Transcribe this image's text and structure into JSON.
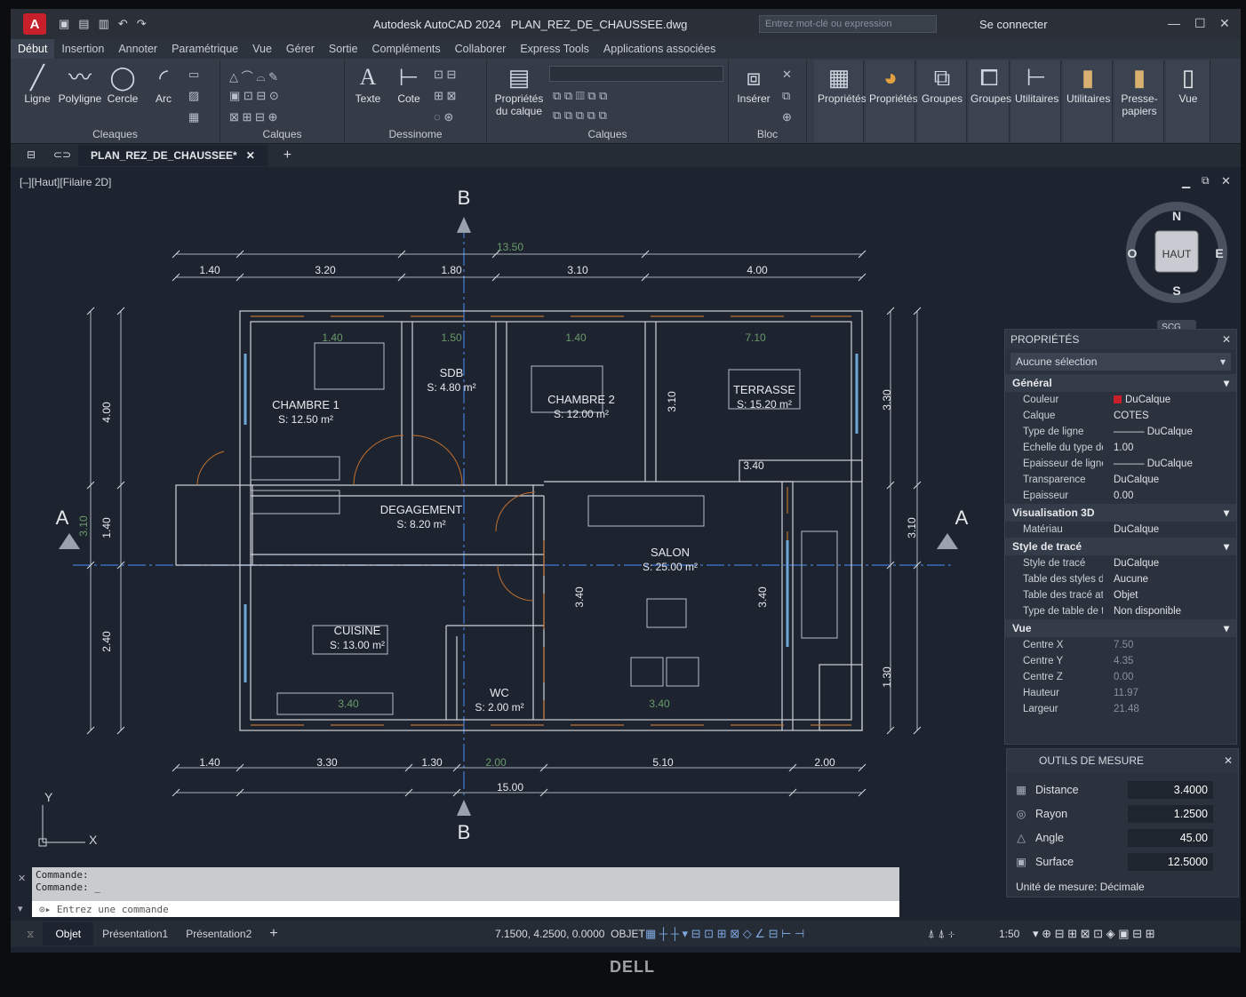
{
  "window": {
    "app_icon": "A",
    "title": "Autodesk AutoCAD 2024",
    "filename": "PLAN_REZ_DE_CHAUSSEE.dwg",
    "search_placeholder": "Entrez mot-clé ou expression",
    "signin": "Se connecter"
  },
  "ribbon_tabs": [
    "Début",
    "Insertion",
    "Annoter",
    "Paramétrique",
    "Vue",
    "Gérer",
    "Sortie",
    "Compléments",
    "Collaborer",
    "Express Tools",
    "Applications associées"
  ],
  "ribbon": {
    "tools": {
      "ligne": "Ligne",
      "polyligne": "Polyligne",
      "cercle": "Cercle",
      "arc": "Arc",
      "texte": "Texte",
      "cote": "Cote",
      "proprietes_calque": "Propriétés du calque",
      "inserer": "Insérer",
      "proprietes": "Propriétés",
      "proprietes2": "Propriétés",
      "groupes": "Groupes",
      "groupes2": "Groupes",
      "utilitaires": "Utilitaires",
      "utilitaires2": "Utilitaires",
      "presse_papiers": "Presse-papiers",
      "vue": "Vue"
    },
    "panels": {
      "dessiner": "Cleaques",
      "modifier": "Calques",
      "annotation": "Dessinome",
      "calques": "Calques",
      "bloc": "Bloc"
    }
  },
  "doc_tab": "PLAN_REZ_DE_CHAUSSEE*",
  "viewport_label": "[–][Haut][Filaire 2D]",
  "viewcube": {
    "top": "HAUT",
    "n": "N",
    "s": "S",
    "e": "E",
    "w": "O",
    "wcs": "SCG"
  },
  "plan": {
    "rooms": [
      {
        "name": "CHAMBRE 1",
        "area": "S: 12.50 m²"
      },
      {
        "name": "SDB",
        "area": "S: 4.80 m²"
      },
      {
        "name": "CHAMBRE 2",
        "area": "S: 12.00 m²"
      },
      {
        "name": "TERRASSE",
        "area": "S: 15.20 m²"
      },
      {
        "name": "DEGAGEMENT",
        "area": "S: 8.20 m²"
      },
      {
        "name": "SALON",
        "area": "S: 25.00 m²"
      },
      {
        "name": "CUISINE",
        "area": "S: 13.00 m²"
      },
      {
        "name": "WC",
        "area": "S: 2.00 m²"
      }
    ],
    "top_dims": [
      "1.40",
      "3.20",
      "1.80",
      "3.10",
      "4.00"
    ],
    "top_total": "13.50",
    "bottom_dims": [
      "1.40",
      "3.30",
      "1.30",
      "2.00",
      "5.10",
      "2.00"
    ],
    "bottom_total": "15.00",
    "left_dims": [
      "4.00",
      "1.40",
      "2.40"
    ],
    "left_small": "3.10",
    "right_dims": [
      "3.30",
      "3.10",
      "1.30"
    ],
    "inner_dims": [
      "1.40",
      "1.50",
      "1.40",
      "7.10",
      "3.40",
      "3.10",
      "3.40",
      "3.40",
      "3.40",
      "3.40"
    ],
    "section_labels": {
      "b_top": "B",
      "b_bottom": "B",
      "a_left": "A",
      "a_right": "A"
    },
    "axis": {
      "x": "X",
      "y": "Y"
    }
  },
  "properties": {
    "title": "PROPRIÉTÉS",
    "selection": "Aucune sélection",
    "sections": [
      {
        "name": "Général",
        "rows": [
          {
            "k": "Couleur",
            "v": "DuCalque"
          },
          {
            "k": "Calque",
            "v": "COTES"
          },
          {
            "k": "Type de ligne",
            "v": "——— DuCalque"
          },
          {
            "k": "Echelle du type de...",
            "v": "1.00"
          },
          {
            "k": "Epaisseur de ligne",
            "v": "——— DuCalque"
          },
          {
            "k": "Transparence",
            "v": "DuCalque"
          },
          {
            "k": "Epaisseur",
            "v": "0.00"
          }
        ]
      },
      {
        "name": "Visualisation 3D",
        "rows": [
          {
            "k": "Matériau",
            "v": "DuCalque"
          }
        ]
      },
      {
        "name": "Style de tracé",
        "rows": [
          {
            "k": "Style de tracé",
            "v": "DuCalque"
          },
          {
            "k": "Table des styles de...",
            "v": "Aucune"
          },
          {
            "k": "Table des tracé atta...",
            "v": "Objet"
          },
          {
            "k": "Type de table de tr...",
            "v": "Non disponible"
          }
        ]
      },
      {
        "name": "Vue",
        "rows": [
          {
            "k": "Centre X",
            "v": "7.50"
          },
          {
            "k": "Centre Y",
            "v": "4.35"
          },
          {
            "k": "Centre Z",
            "v": "0.00"
          },
          {
            "k": "Hauteur",
            "v": "11.97"
          },
          {
            "k": "Largeur",
            "v": "21.48"
          }
        ]
      }
    ]
  },
  "measure": {
    "title": "OUTILS DE MESURE",
    "rows": [
      {
        "label": "Distance",
        "value": "3.4000"
      },
      {
        "label": "Rayon",
        "value": "1.2500"
      },
      {
        "label": "Angle",
        "value": "45.00"
      },
      {
        "label": "Surface",
        "value": "12.5000"
      }
    ],
    "unit": "Unité de mesure:  Décimale"
  },
  "command": {
    "history": [
      "Commande:",
      "Commande: _"
    ],
    "placeholder": "Entrez une commande"
  },
  "status": {
    "tabs": [
      "Objet",
      "Présentation1",
      "Présentation2"
    ],
    "coords": "7.1500, 4.2500, 0.0000",
    "mode": "OBJET",
    "scale": "1:50"
  },
  "brand": "DELL",
  "colors": {
    "background": "#1d2430",
    "wall": "#cfd3d8",
    "hatch": "#c07030",
    "dim": "#d8dde4",
    "section_line": "#3b6db8",
    "accent_red": "#c7202a"
  }
}
